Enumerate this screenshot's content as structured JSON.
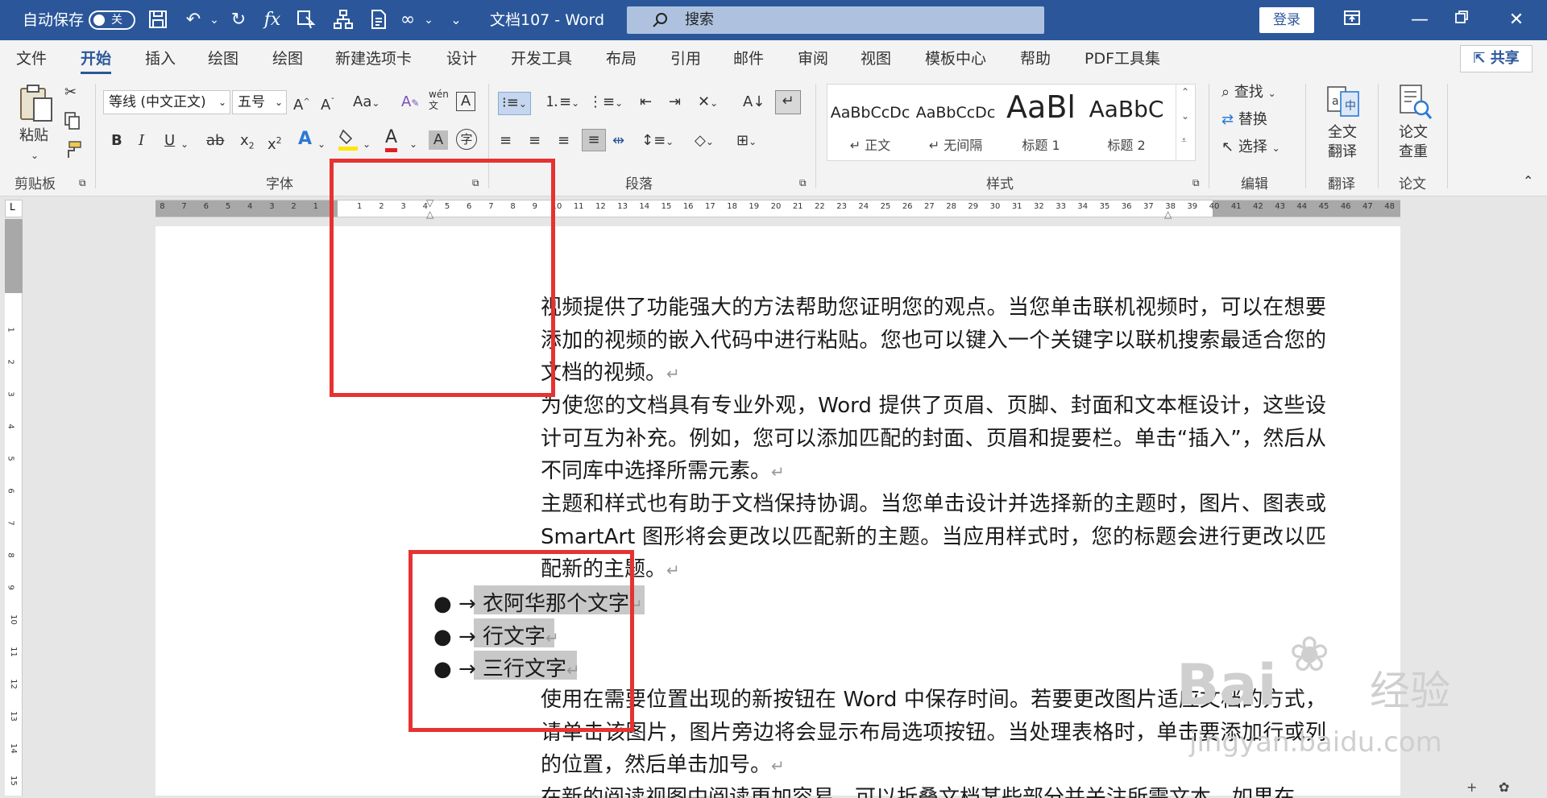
{
  "titlebar": {
    "autosave_label": "自动保存",
    "autosave_state": "关",
    "doc_title": "文档107  -  Word",
    "search_label": "搜索",
    "login_label": "登录"
  },
  "tabs": [
    "文件",
    "开始",
    "插入",
    "绘图",
    "绘图",
    "新建选项卡",
    "设计",
    "开发工具",
    "布局",
    "引用",
    "邮件",
    "审阅",
    "视图",
    "模板中心",
    "帮助",
    "PDF工具集"
  ],
  "share_label": "共享",
  "ribbon": {
    "clipboard": {
      "paste": "粘贴",
      "group": "剪贴板"
    },
    "font": {
      "font_name": "等线 (中文正文)",
      "font_size": "五号",
      "group": "字体"
    },
    "paragraph": {
      "group": "段落"
    },
    "styles": {
      "group": "样式",
      "items": [
        {
          "preview": "AaBbCcDc",
          "name": "↵ 正文"
        },
        {
          "preview": "AaBbCcDc",
          "name": "↵ 无间隔"
        },
        {
          "preview": "AaBl",
          "name": "标题 1"
        },
        {
          "preview": "AaBbC",
          "name": "标题 2"
        }
      ]
    },
    "editing": {
      "find": "查找",
      "replace": "替换",
      "select": "选择",
      "group": "编辑"
    },
    "translate": {
      "full": "全文",
      "full2": "翻译",
      "group": "翻译"
    },
    "paper": {
      "check": "论文",
      "check2": "查重",
      "group": "论文"
    }
  },
  "document": {
    "para1": "视频提供了功能强大的方法帮助您证明您的观点。当您单击联机视频时，可以在想要添加的视频的嵌入代码中进行粘贴。您也可以键入一个关键字以联机搜索最适合您的文档的视频。",
    "para2": "为使您的文档具有专业外观，Word 提供了页眉、页脚、封面和文本框设计，这些设计可互为补充。例如，您可以添加匹配的封面、页眉和提要栏。单击“插入”，然后从不同库中选择所需元素。",
    "para3": "主题和样式也有助于文档保持协调。当您单击设计并选择新的主题时，图片、图表或 SmartArt 图形将会更改以匹配新的主题。当应用样式时，您的标题会进行更改以匹配新的主题。",
    "bullets": [
      "衣阿华那个文字",
      "行文字",
      "三行文字"
    ],
    "para4": "使用在需要位置出现的新按钮在 Word 中保存时间。若要更改图片适应文档的方式，请单击该图片，图片旁边将会显示布局选项按钮。当处理表格时，单击要添加行或列的位置，然后单击加号。",
    "para5": "在新的阅读视图中阅读更加容易。可以折叠文档某些部分并关注所需文本。如果在"
  },
  "watermark": {
    "brand": "Bai",
    "brand_cn": "经验",
    "url": "jingyan.baidu.com"
  }
}
